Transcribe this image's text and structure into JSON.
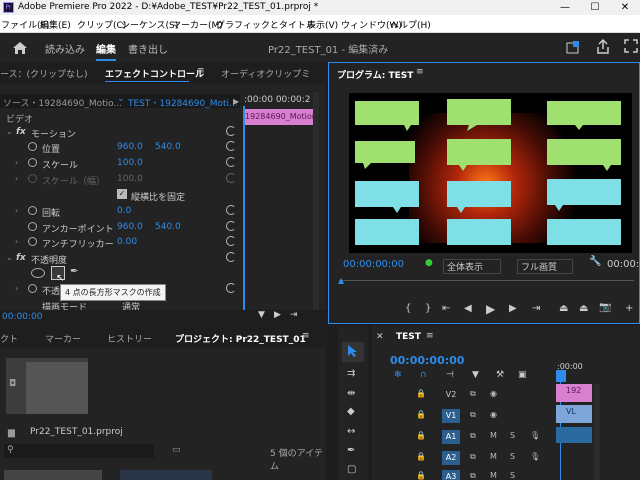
{
  "titlebar": {
    "title": "Adobe Premiere Pro 2022 - D:¥Adobe_TEST¥Pr22_TEST_01.prproj *",
    "icon": "Pr",
    "min": "—",
    "max": "☐",
    "close": "✕"
  },
  "menu": [
    "ファイル(F)",
    "編集(E)",
    "クリップ(C)",
    "シーケンス(S)",
    "マーカー(M)",
    "グラフィックとタイトル",
    "表示(V)",
    "ウィンドウ(W)",
    "ヘルプ(H)"
  ],
  "header": {
    "import": "読み込み",
    "edit": "編集",
    "export": "書き出し",
    "project_title": "Pr22_TEST_01 - 編集済み"
  },
  "effect_panel": {
    "tab_source": "ース：(クリップなし)",
    "tab_effect": "エフェクトコントロール",
    "tab_audio": "オーディオクリップミ",
    "source_clip": "ソース・19284690_Motio...",
    "seq_clip": "TEST・19284690_Moti...",
    "mini_time": ":00:00  00:00:2",
    "clip_label": "19284690_Motion",
    "video": "ビデオ",
    "motion": "モーション",
    "position": "位置",
    "pos_x": "960.0",
    "pos_y": "540.0",
    "scale": "スケール",
    "scale_v": "100.0",
    "scale_w": "スケール（幅）",
    "scale_w_v": "100.0",
    "uniform": "縦横比を固定",
    "rotation": "回転",
    "rotation_v": "0.0",
    "anchor": "アンカーポイント",
    "anchor_x": "960.0",
    "anchor_y": "540.0",
    "antiflicker": "アンチフリッカー",
    "antiflicker_v": "0.00",
    "opacity": "不透明度",
    "opacity_sub": "不透",
    "blend": "描画モード",
    "blend_v": "通常",
    "tooltip": "4 点の長方形マスクの作成",
    "time": "00:00:00"
  },
  "program": {
    "title": "プログラム: TEST",
    "timecode": "00:00:00:00",
    "fit": "全体表示",
    "quality": "フル画質",
    "timecode_right": "00:00:0"
  },
  "project_panel": {
    "tab1": "クト",
    "tab2": "マーカー",
    "tab3": "ヒストリー",
    "tab4": "プロジェクト: Pr22_TEST_01",
    "file": "Pr22_TEST_01.prproj",
    "items": "5 個のアイテム"
  },
  "timeline": {
    "seq": "TEST",
    "timecode": "00:00:00:00",
    "ruler": ":00:00",
    "tracks": [
      {
        "name": "V2",
        "clip": "192"
      },
      {
        "name": "V1",
        "clip": "VL"
      },
      {
        "name": "A1",
        "clip": ""
      },
      {
        "name": "A2",
        "clip": ""
      },
      {
        "name": "A3",
        "clip": ""
      }
    ],
    "m": "M",
    "s": "S"
  },
  "colors": {
    "accent": "#2d8ceb",
    "clip_pink": "#d97fd0",
    "clip_blue": "#7fa6d9",
    "bubble_green": "#a0e070",
    "bubble_cyan": "#7ee0e6"
  }
}
